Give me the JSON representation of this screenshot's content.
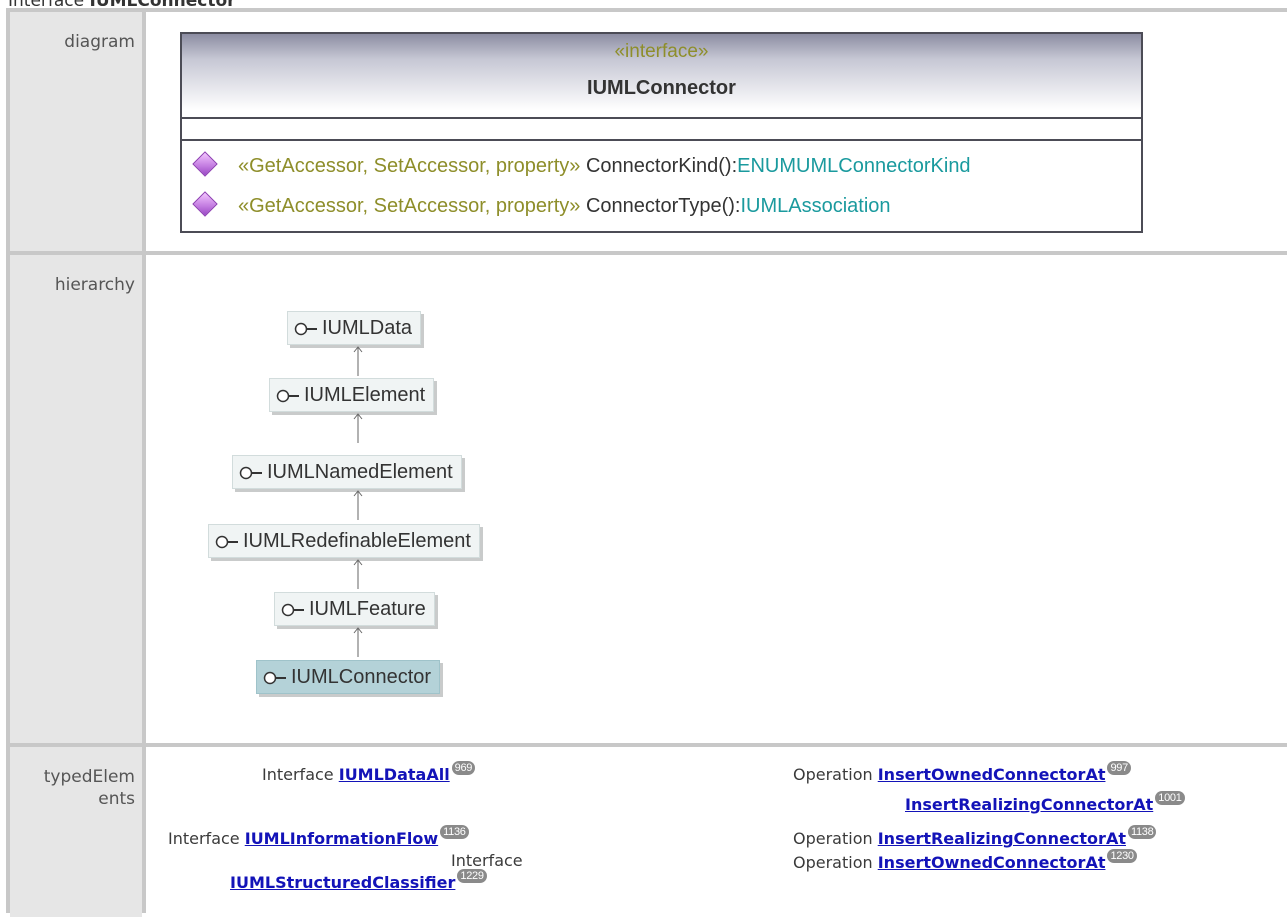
{
  "heading": {
    "prefix": "Interface ",
    "name": "IUMLConnector"
  },
  "rows": {
    "diagram": "diagram",
    "hierarchy": "hierarchy",
    "typed_line1": "typedElem",
    "typed_line2": "ents"
  },
  "uml": {
    "stereotype": "«interface»",
    "name": "IUMLConnector",
    "operations": [
      {
        "stereotype": "«GetAccessor, SetAccessor, property»",
        "signature": " ConnectorKind():",
        "type": "ENUMUMLConnectorKind"
      },
      {
        "stereotype": "«GetAccessor, SetAccessor, property»",
        "signature": " ConnectorType():",
        "type": "IUMLAssociation"
      }
    ]
  },
  "hierarchy": [
    "IUMLData",
    "IUMLElement",
    "IUMLNamedElement",
    "IUMLRedefinableElement",
    "IUMLFeature",
    "IUMLConnector"
  ],
  "typed_elements": {
    "interfaces": [
      {
        "kind": "Interface",
        "name": "IUMLDataAll",
        "badge": "969"
      },
      {
        "kind": "Interface",
        "name": "IUMLInformationFlow",
        "badge": "1136"
      },
      {
        "kind": "Interface",
        "name": "IUMLStructuredClassifier",
        "badge": "1229"
      }
    ],
    "operations": [
      {
        "kind": "Operation",
        "name": "InsertOwnedConnectorAt",
        "badge": "997"
      },
      {
        "kind": "",
        "name": "InsertRealizingConnectorAt",
        "badge": "1001"
      },
      {
        "kind": "Operation",
        "name": "InsertRealizingConnectorAt",
        "badge": "1138"
      },
      {
        "kind": "Operation",
        "name": "InsertOwnedConnectorAt",
        "badge": "1230"
      }
    ]
  }
}
